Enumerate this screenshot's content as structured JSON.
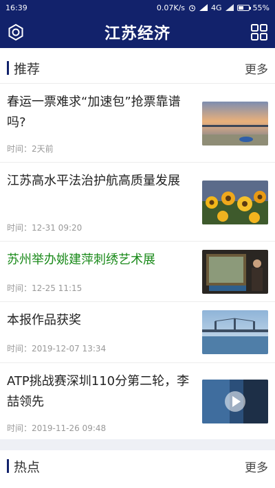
{
  "status_bar": {
    "time": "16:39",
    "speed": "0.07K/s",
    "network": "4G",
    "battery": "55%",
    "battery_level": 0.55
  },
  "app_bar": {
    "title": "江苏经济",
    "left_icon": "target-circle-icon",
    "right_icon": "grid-menu-icon"
  },
  "recommended": {
    "label": "推荐",
    "more": "更多"
  },
  "news": [
    {
      "title": "春运一票难求“加速包”抢票靠谱吗?",
      "time": "时间：2天前",
      "highlight": false,
      "thumb": "sunset-bridge-lake"
    },
    {
      "title": "江苏高水平法治护航高质量发展",
      "time": "时间：12-31 09:20",
      "highlight": false,
      "thumb": "sunflowers"
    },
    {
      "title": "苏州举办姚建萍刺绣艺术展",
      "time": "时间：12-25 11:15",
      "highlight": true,
      "thumb": "embroidery-exhibit"
    },
    {
      "title": "本报作品获奖",
      "time": "时间：2019-12-07 13:34",
      "highlight": false,
      "thumb": "river-bridge"
    },
    {
      "title": "ATP挑战赛深圳110分第二轮，李喆领先",
      "time": "时间：2019-11-26 09:48",
      "highlight": false,
      "thumb": "video-play"
    }
  ],
  "hot": {
    "label": "热点",
    "more": "更多"
  },
  "colors": {
    "brand": "#12226b",
    "highlight_text": "#1a8a1a"
  }
}
